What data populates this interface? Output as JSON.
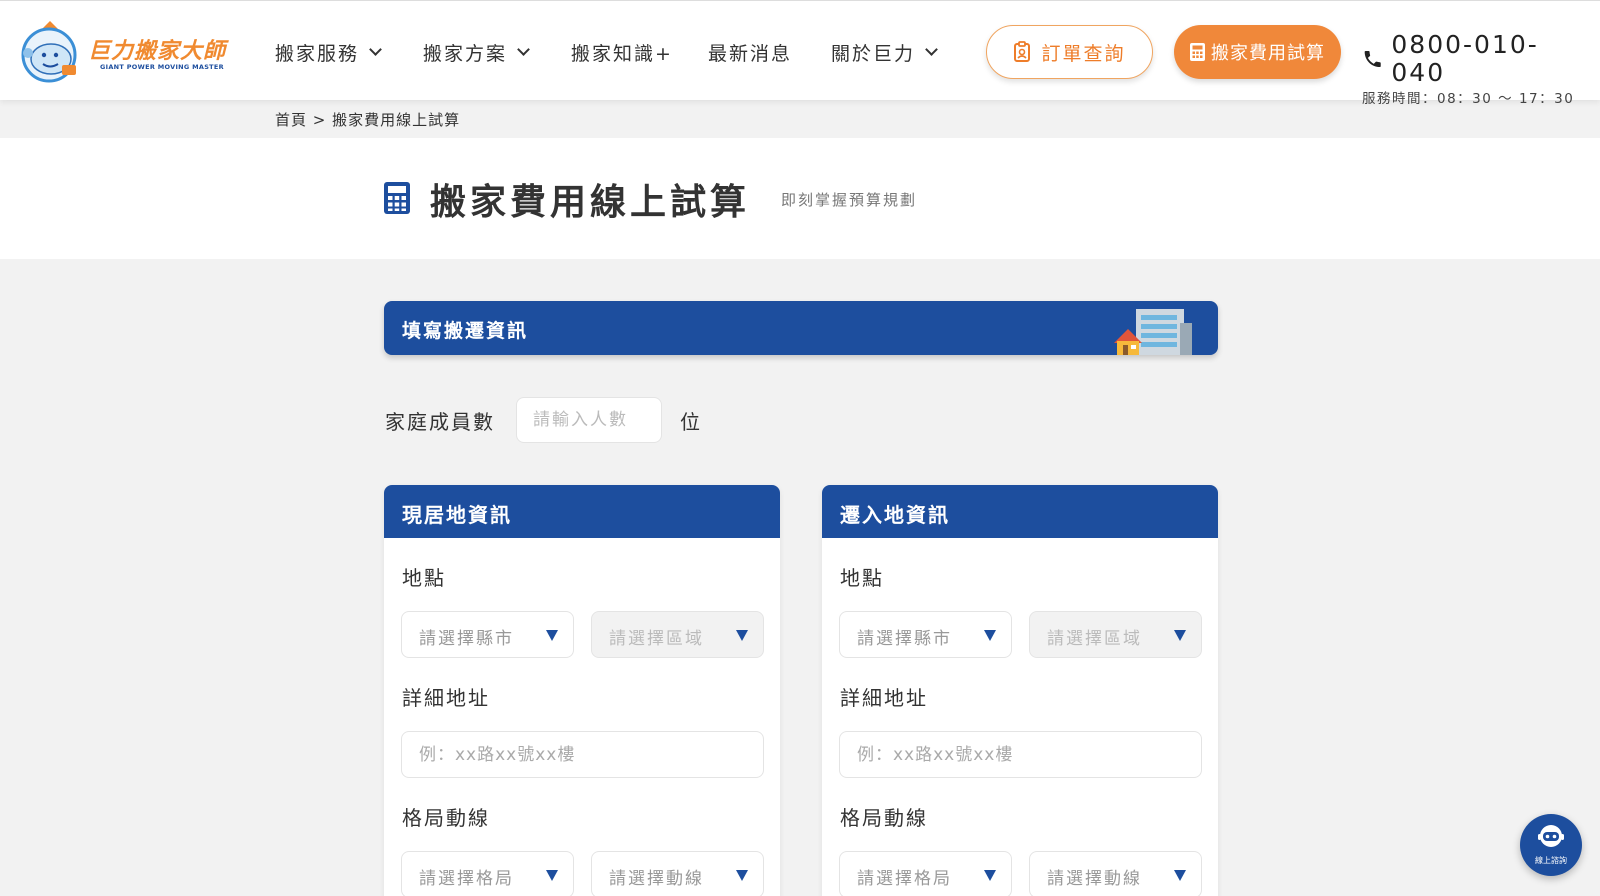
{
  "brand": {
    "name": "巨力搬家大師",
    "tagline": "GIANT POWER MOVING MASTER"
  },
  "nav": {
    "items": [
      {
        "label": "搬家服務",
        "dropdown": true
      },
      {
        "label": "搬家方案",
        "dropdown": true
      },
      {
        "label": "搬家知識+",
        "dropdown": false
      },
      {
        "label": "最新消息",
        "dropdown": false
      },
      {
        "label": "關於巨力",
        "dropdown": true
      }
    ],
    "order_button": "訂單查詢",
    "calc_button": "搬家費用試算"
  },
  "contact": {
    "phone": "0800-010-040",
    "hours": "服務時間：08：30 ～ 17：30"
  },
  "breadcrumb": "首頁 > 搬家費用線上試算",
  "page": {
    "title": "搬家費用線上試算",
    "subtitle": "即刻掌握預算規劃"
  },
  "form": {
    "section_title": "填寫搬遷資訊",
    "family": {
      "label": "家庭成員數",
      "placeholder": "請輸入人數",
      "unit": "位"
    },
    "panels": [
      {
        "title": "現居地資訊",
        "location_label": "地點",
        "city_placeholder": "請選擇縣市",
        "district_placeholder": "請選擇區域",
        "address_label": "詳細地址",
        "address_placeholder": "例：xx路xx號xx樓",
        "layout_label": "格局動線",
        "layout_placeholder": "請選擇格局",
        "route_placeholder": "請選擇動線"
      },
      {
        "title": "遷入地資訊",
        "location_label": "地點",
        "city_placeholder": "請選擇縣市",
        "district_placeholder": "請選擇區域",
        "address_label": "詳細地址",
        "address_placeholder": "例：xx路xx號xx樓",
        "layout_label": "格局動線",
        "layout_placeholder": "請選擇格局",
        "route_placeholder": "請選擇動線"
      }
    ]
  },
  "chat": {
    "label": "線上諮詢"
  },
  "colors": {
    "brand_blue": "#1d4e9e",
    "accent_orange": "#f0883a"
  }
}
